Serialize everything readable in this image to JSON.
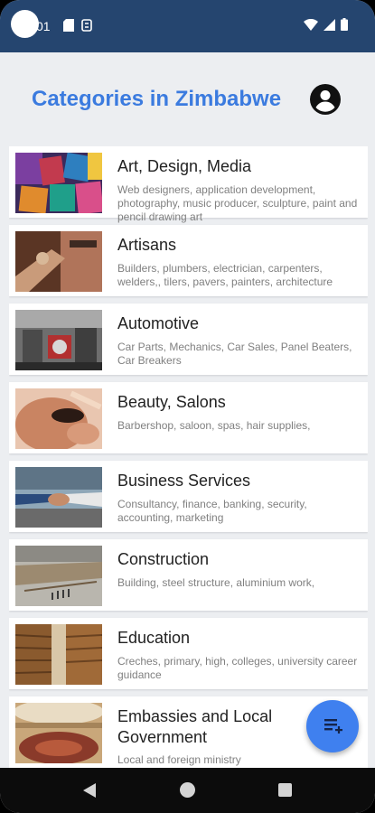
{
  "status_bar": {
    "time_partial": "01",
    "icons": [
      "sd-card-icon",
      "storage-icon",
      "wifi-icon",
      "signal-icon",
      "battery-icon"
    ]
  },
  "header": {
    "title": "Categories in Zimbabwe",
    "profile_icon": "account-circle-icon"
  },
  "categories": [
    {
      "title": "Art, Design, Media",
      "description": "Web designers, application development, photography, music producer, sculpture, paint and pencil drawing art",
      "image": "art-fabric-image"
    },
    {
      "title": "Artisans",
      "description": "Builders, plumbers, electrician, carpenters, welders,, tilers, pavers, painters, architecture",
      "image": "artisan-tools-image"
    },
    {
      "title": "Automotive",
      "description": "Car Parts, Mechanics, Car Sales, Panel Beaters, Car Breakers",
      "image": "car-factory-image"
    },
    {
      "title": "Beauty, Salons",
      "description": "Barbershop, saloon, spas, hair supplies,",
      "image": "makeup-image"
    },
    {
      "title": "Business Services",
      "description": "Consultancy, finance, banking, security, accounting, marketing",
      "image": "handshake-image"
    },
    {
      "title": "Construction",
      "description": "Building, steel structure, aluminium work,",
      "image": "construction-site-image"
    },
    {
      "title": "Education",
      "description": "Creches, primary, high, colleges, university career guidance",
      "image": "library-image"
    },
    {
      "title": "Embassies and Local Government",
      "description": "Local and foreign ministry",
      "image": "parliament-hall-image"
    }
  ],
  "fab": {
    "icon": "add-to-list-icon"
  },
  "navigation": {
    "back": "back-icon",
    "home": "home-icon",
    "recents": "recents-icon"
  },
  "colors": {
    "status_bar": "#25456f",
    "title": "#3b7bdf",
    "fab": "#3f80ef",
    "background": "#eceef1"
  }
}
